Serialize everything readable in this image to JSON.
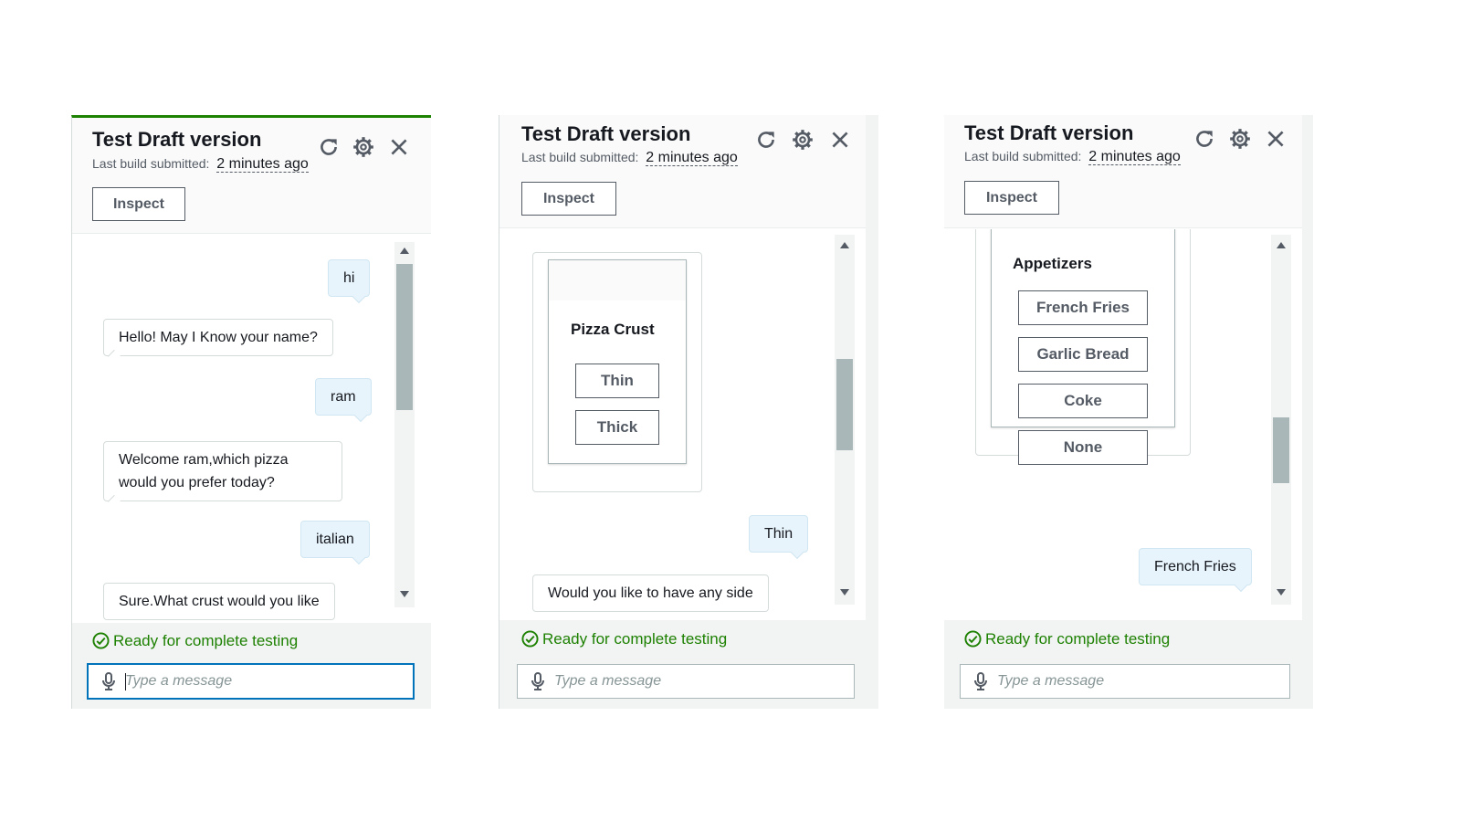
{
  "panel_common": {
    "title": "Test Draft version",
    "subtitle_prefix": "Last build submitted:",
    "subtitle_time": "2 minutes ago",
    "inspect_label": "Inspect",
    "status_text": "Ready for complete testing",
    "input_placeholder": "Type a message",
    "icons": [
      "refresh-icon",
      "gear-icon",
      "close-icon",
      "microphone-icon",
      "check-circle-icon"
    ]
  },
  "panels": [
    {
      "messages": [
        {
          "from": "user",
          "text": "hi"
        },
        {
          "from": "bot",
          "text": "Hello! May I Know your name?"
        },
        {
          "from": "user",
          "text": "ram"
        },
        {
          "from": "bot",
          "lines": [
            "Welcome ram,which pizza",
            "would you prefer today?"
          ]
        },
        {
          "from": "user",
          "text": "italian"
        },
        {
          "from": "bot",
          "text": "Sure.What crust would you like"
        }
      ],
      "input_focused": true
    },
    {
      "card": {
        "title": "Pizza Crust",
        "options": [
          "Thin",
          "Thick"
        ]
      },
      "messages": [
        {
          "from": "user",
          "text": "Thin"
        },
        {
          "from": "bot",
          "text": "Would you like to have any side"
        }
      ],
      "input_focused": false
    },
    {
      "card": {
        "title": "Appetizers",
        "options": [
          "French Fries",
          "Garlic Bread",
          "Coke",
          "None"
        ]
      },
      "messages": [
        {
          "from": "user",
          "text": "French Fries"
        }
      ],
      "input_focused": false
    }
  ],
  "colors": {
    "accent_green": "#1d8102",
    "focus_blue": "#0073bb",
    "user_bubble": "#e8f4fb",
    "header_bg": "#fafafa",
    "footer_bg": "#f2f3f3"
  }
}
